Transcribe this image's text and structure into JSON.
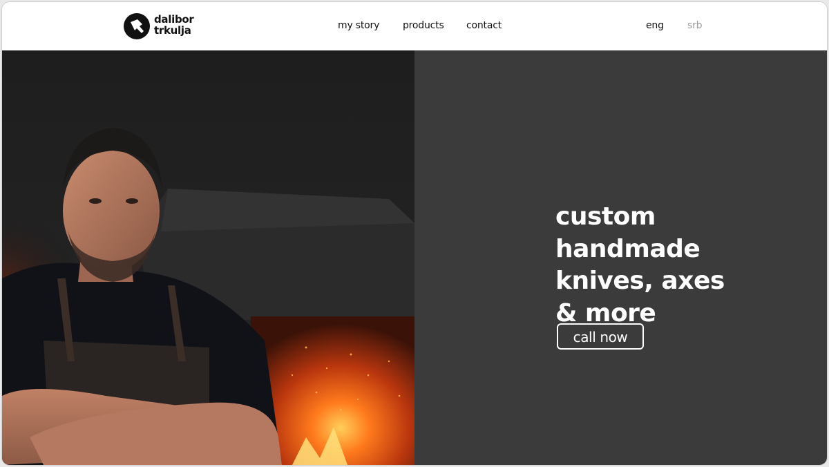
{
  "brand": {
    "name_line1": "dalibor",
    "name_line2": "trkulja",
    "logo_icon": "hammer-icon"
  },
  "nav": {
    "items": [
      {
        "label": "my story"
      },
      {
        "label": "products"
      },
      {
        "label": "contact"
      }
    ]
  },
  "language": {
    "options": [
      {
        "label": "eng",
        "active": true
      },
      {
        "label": "srb",
        "active": false
      }
    ]
  },
  "hero": {
    "headline_lines": [
      "custom",
      "handmade",
      "knives, axes",
      "& more"
    ],
    "cta_label": "call now"
  },
  "colors": {
    "panel": "#3b3b3b",
    "text_on_panel": "#ffffff",
    "inactive_lang": "#9a9a9a",
    "fire_glow": "#ff6a1a"
  }
}
